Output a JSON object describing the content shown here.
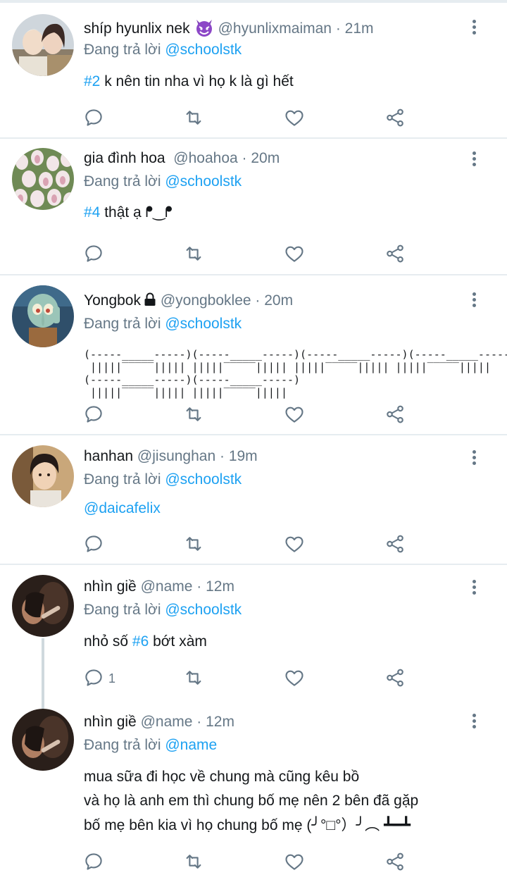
{
  "reply_prefix": "Đang trả lời",
  "tweets": [
    {
      "name": "shíp hyunlix nek",
      "handle": "@hyunlixmaiman",
      "time": "21m",
      "reply_to": "@schoolstk",
      "hashtag": "#2",
      "text": " k nên tin nha vì họ k là gì hết"
    },
    {
      "name": "gia đình hoa",
      "handle": "@hoahoa",
      "time": "20m",
      "reply_to": "@schoolstk",
      "hashtag": "#4",
      "text": " thật ạ ᖰ‿ᖰ"
    },
    {
      "name": "Yongbok",
      "handle": "@yongboklee",
      "time": "20m",
      "reply_to": "@schoolstk",
      "ascii_line1": "(-----_____-----)(-----_____-----)(-----_____-----)(-----_____-----)",
      "ascii_line2": " |||||‾‾‾‾‾||||| |||||‾‾‾‾‾||||| |||||‾‾‾‾‾||||| |||||‾‾‾‾‾|||||",
      "ascii_line3": "(-----_____-----)(-----_____-----)",
      "ascii_line4": " |||||‾‾‾‾‾||||| |||||‾‾‾‾‾|||||"
    },
    {
      "name": "hanhan",
      "handle": "@jisunghan",
      "time": "19m",
      "reply_to": "@schoolstk",
      "mention_text": "@daicafelix"
    },
    {
      "name": "nhìn giề",
      "handle": "@name",
      "time": "12m",
      "reply_to": "@schoolstk",
      "text_before": "nhỏ số ",
      "hashtag": "#6",
      "text_after": " bớt xàm",
      "reply_count": "1"
    },
    {
      "name": "nhìn giề",
      "handle": "@name",
      "time": "12m",
      "reply_to": "@name",
      "line1": "mua sữa đi học về chung mà cũng kêu bồ",
      "line2": "và họ là anh em thì chung bố mẹ nên 2 bên đã gặp",
      "line3": "bố mẹ bên kia vì họ chung bố mẹ (╯°□°）╯︵ ┻━┻"
    }
  ],
  "dot": "·",
  "colors": {
    "link": "#1da1f2",
    "muted": "#657786",
    "text": "#14171a",
    "divider": "#e6ecf0"
  },
  "icons": [
    "reply-icon",
    "retweet-icon",
    "like-icon",
    "share-icon",
    "more-icon",
    "lock-icon",
    "devil-emoji"
  ]
}
